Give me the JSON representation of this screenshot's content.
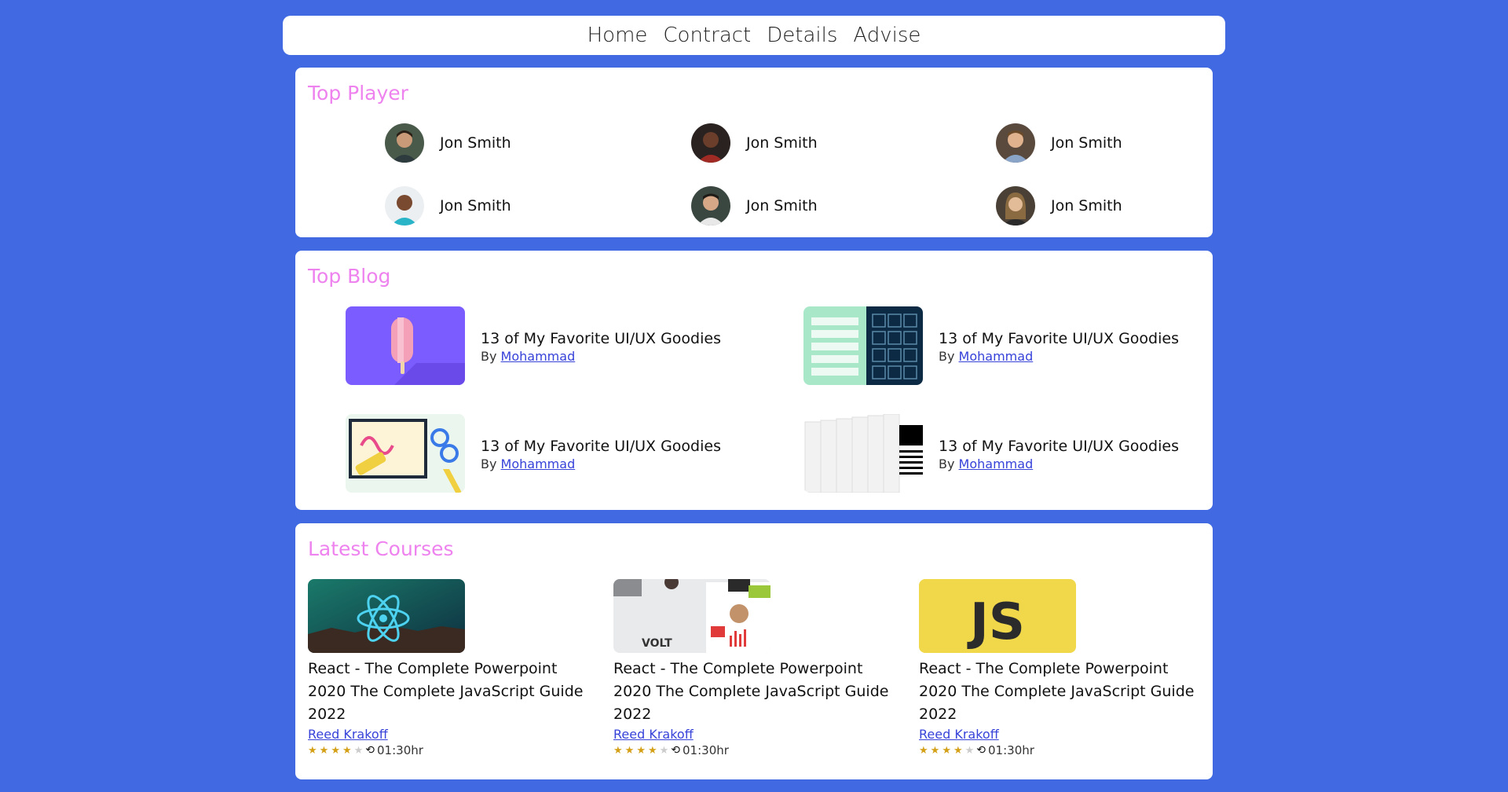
{
  "nav": {
    "items": [
      "Home",
      "Contract",
      "Details",
      "Advise"
    ]
  },
  "players": {
    "title": "Top Player",
    "items": [
      {
        "name": "Jon Smith"
      },
      {
        "name": "Jon Smith"
      },
      {
        "name": "Jon Smith"
      },
      {
        "name": "Jon Smith"
      },
      {
        "name": "Jon Smith"
      },
      {
        "name": "Jon Smith"
      }
    ]
  },
  "blogs": {
    "title": "Top Blog",
    "items": [
      {
        "title": "13 of My Favorite UI/UX Goodies",
        "by": "By",
        "author": "Mohammad"
      },
      {
        "title": "13 of My Favorite UI/UX Goodies",
        "by": "By",
        "author": "Mohammad"
      },
      {
        "title": "13 of My Favorite UI/UX Goodies",
        "by": "By",
        "author": "Mohammad"
      },
      {
        "title": "13 of My Favorite UI/UX Goodies",
        "by": "By",
        "author": "Mohammad"
      }
    ]
  },
  "courses": {
    "title": "Latest Courses",
    "items": [
      {
        "title": "React - The Complete Powerpoint 2020 The Complete JavaScript Guide 2022",
        "author": "Reed Krakoff",
        "rating": 4,
        "duration": "01:30hr"
      },
      {
        "title": "React - The Complete Powerpoint 2020 The Complete JavaScript Guide 2022",
        "author": "Reed Krakoff",
        "rating": 4,
        "duration": "01:30hr",
        "thumb_text": "VOLT"
      },
      {
        "title": "React - The Complete Powerpoint 2020 The Complete JavaScript Guide 2022",
        "author": "Reed Krakoff",
        "rating": 4,
        "duration": "01:30hr",
        "thumb_text": "JS"
      }
    ]
  },
  "colors": {
    "background": "#4169e1",
    "section_title": "#ee82ee",
    "link": "#3742d9",
    "star": "#d4a017"
  }
}
